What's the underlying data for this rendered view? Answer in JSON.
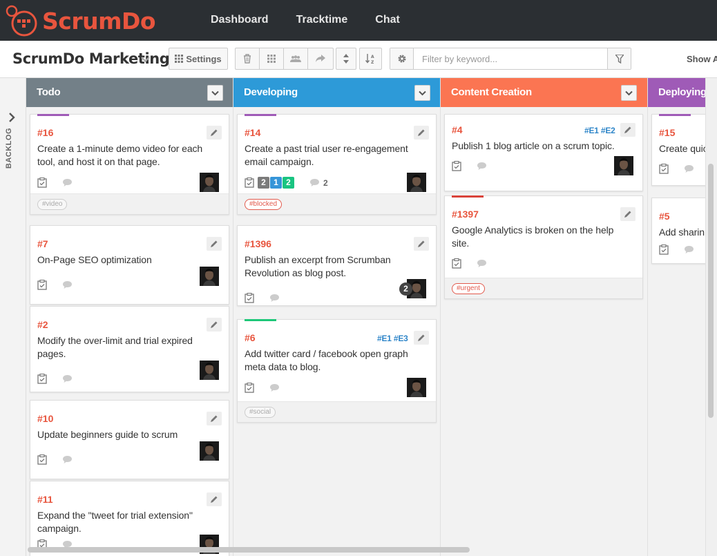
{
  "brand": {
    "name": "ScrumDo"
  },
  "nav": {
    "items": [
      "Dashboard",
      "Tracktime",
      "Chat"
    ]
  },
  "toolbar": {
    "project": "ScrumDo Marketing",
    "settings_label": "Settings",
    "filter_placeholder": "Filter by keyword...",
    "show_all_label": "Show A"
  },
  "backlog": {
    "label": "BACKLOG"
  },
  "colors": {
    "todo": "#738088",
    "developing": "#2d9ad8",
    "content": "#fb7552",
    "deploying": "#9f5bb7",
    "accent": "#e8553e",
    "epic": "#2f86c9",
    "purple_bar": "#9f5bb7",
    "green_bar": "#1dc778",
    "red_bar": "#d9433a",
    "badge_gray": "#7b7b7b",
    "badge_blue": "#3695d8",
    "badge_green": "#19c481"
  },
  "columns": [
    {
      "title": "Todo"
    },
    {
      "title": "Developing"
    },
    {
      "title": "Content Creation"
    },
    {
      "title": "Deploying"
    }
  ],
  "cards": {
    "todo": [
      {
        "number": "#16",
        "summary": [
          "Create a 1-minute demo video for each",
          "tool, and host it on that page."
        ],
        "tag": "#video"
      },
      {
        "number": "#7",
        "summary": [
          "On-Page SEO optimization"
        ]
      },
      {
        "number": "#2",
        "summary": [
          "Modify the over-limit and trial expired",
          "pages."
        ]
      },
      {
        "number": "#10",
        "summary": [
          "Update beginners guide to scrum"
        ]
      },
      {
        "number": "#11",
        "summary": [
          "Expand the \"tweet for trial extension\"",
          "campaign."
        ]
      }
    ],
    "developing": [
      {
        "number": "#14",
        "summary": [
          "Create a past trial user re-engagement",
          "email campaign."
        ],
        "badges": [
          "2",
          "1",
          "2"
        ],
        "comments": "2",
        "tag": "#blocked"
      },
      {
        "number": "#1396",
        "summary": [
          "Publish an excerpt from Scrumban",
          "Revolution as blog post."
        ],
        "avatar_count": "2"
      },
      {
        "number": "#6",
        "epics": "#E1 #E3",
        "summary": [
          "Add twitter card / facebook open graph",
          "meta data to blog."
        ],
        "tag": "#social"
      }
    ],
    "content": [
      {
        "number": "#4",
        "epics": "#E1 #E2",
        "summary": [
          "Publish 1 blog article on a scrum topic."
        ]
      },
      {
        "number": "#1397",
        "summary": [
          "Google Analytics is broken on the help",
          "site."
        ],
        "tag": "#urgent"
      }
    ],
    "deploying": [
      {
        "number": "#15",
        "summary": [
          "Create quic"
        ]
      },
      {
        "number": "#5",
        "summary": [
          "Add sharin"
        ]
      }
    ]
  },
  "icons": [
    "logo-icon",
    "chevron-down-icon",
    "grid-icon",
    "trash-icon",
    "users-icon",
    "share-icon",
    "sort-icon",
    "sort-alpha-icon",
    "gear-icon",
    "funnel-icon",
    "pencil-icon",
    "checklist-icon",
    "comment-icon",
    "avatar"
  ]
}
